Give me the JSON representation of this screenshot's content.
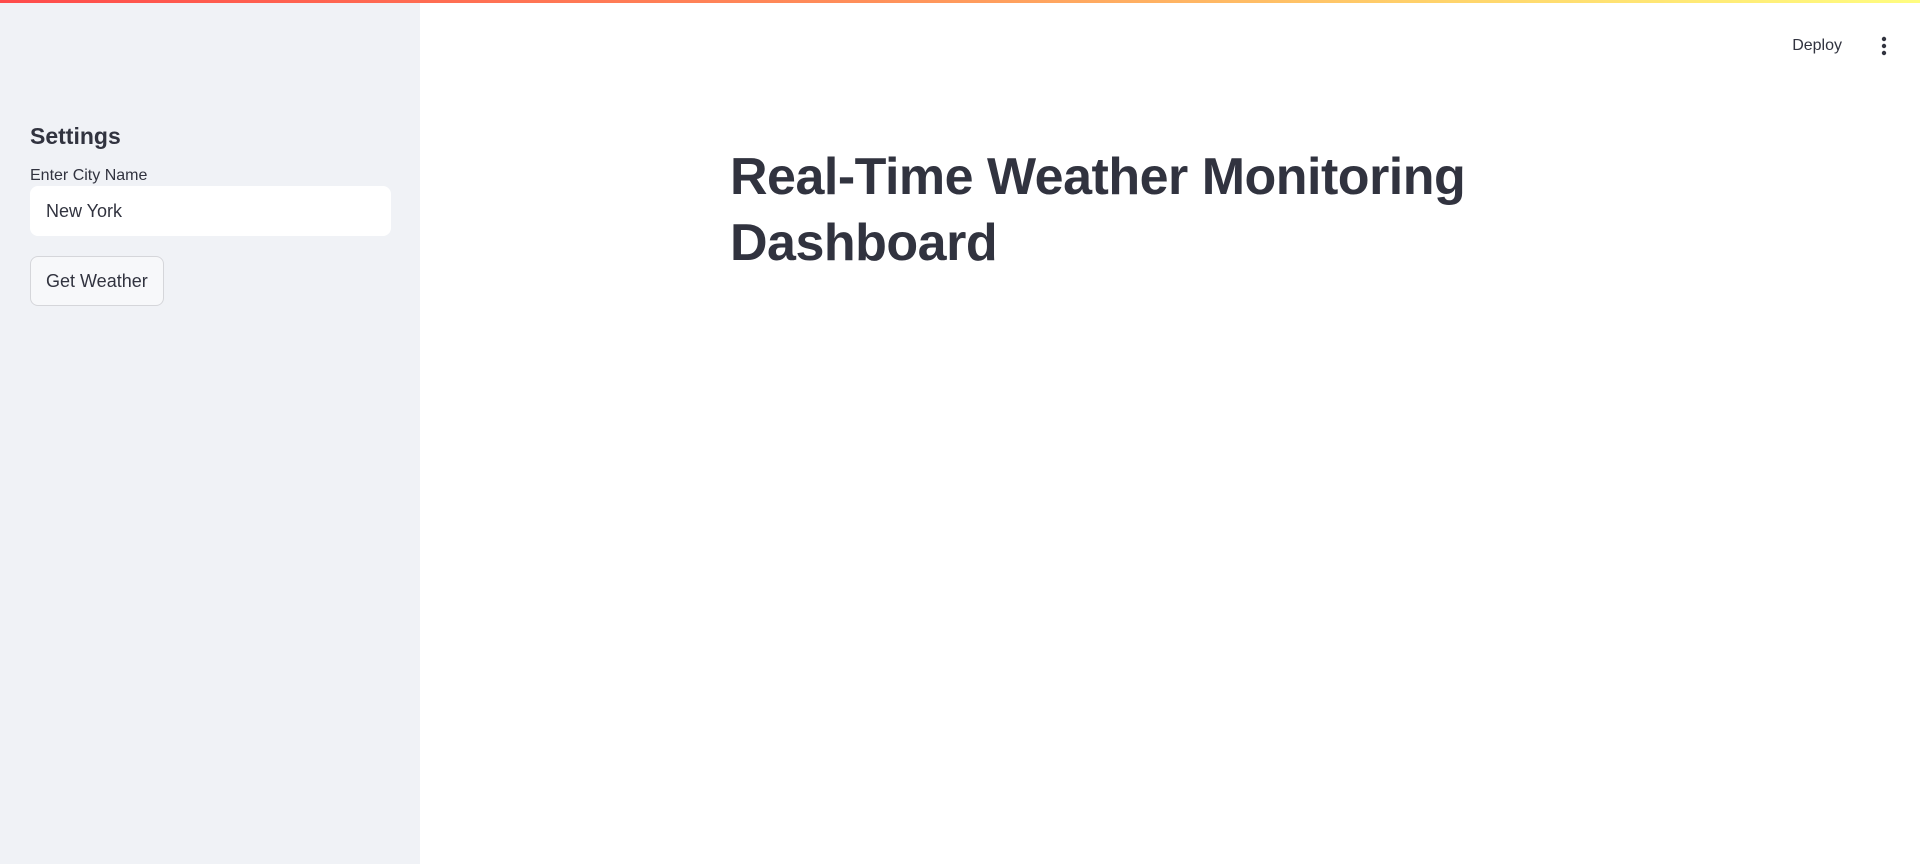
{
  "sidebar": {
    "heading": "Settings",
    "city_field": {
      "label": "Enter City Name",
      "value": "New York"
    },
    "submit_button": "Get Weather"
  },
  "header": {
    "deploy_label": "Deploy",
    "menu_icon": "vertical-ellipsis-icon"
  },
  "main": {
    "title": "Real-Time Weather Monitoring Dashboard"
  },
  "colors": {
    "sidebar_bg": "#f0f2f6",
    "text": "#31333f",
    "decoration_start": "#ff4b4b",
    "decoration_end": "#fffd80"
  }
}
